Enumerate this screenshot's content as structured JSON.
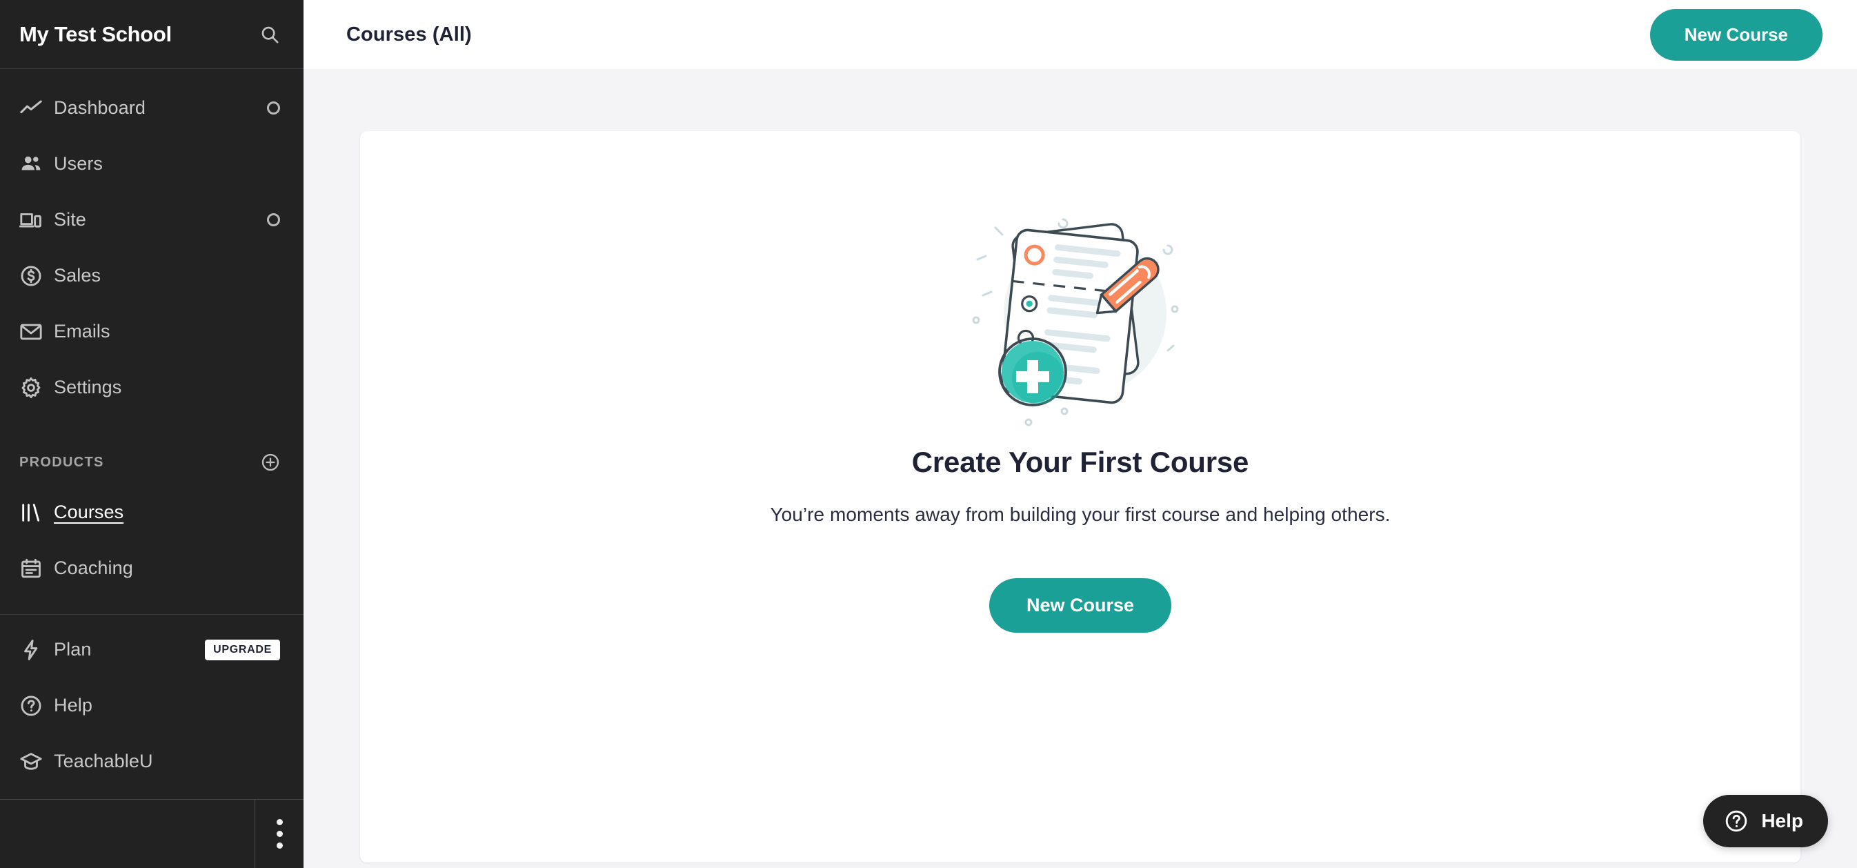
{
  "sidebar": {
    "brand": "My Test School",
    "search_icon": "search-icon",
    "nav": [
      {
        "label": "Dashboard",
        "icon": "trend-line-icon",
        "indicator": "ring",
        "active": false
      },
      {
        "label": "Users",
        "icon": "people-icon",
        "indicator": "",
        "active": false
      },
      {
        "label": "Site",
        "icon": "devices-icon",
        "indicator": "ring",
        "active": false
      },
      {
        "label": "Sales",
        "icon": "dollar-circle-icon",
        "indicator": "",
        "active": false
      },
      {
        "label": "Emails",
        "icon": "envelope-icon",
        "indicator": "",
        "active": false
      },
      {
        "label": "Settings",
        "icon": "gear-icon",
        "indicator": "",
        "active": false
      }
    ],
    "products": {
      "title": "PRODUCTS",
      "add_icon": "plus-circle-icon",
      "items": [
        {
          "label": "Courses",
          "icon": "books-icon",
          "active": true
        },
        {
          "label": "Coaching",
          "icon": "calendar-icon",
          "active": false
        }
      ]
    },
    "utility": [
      {
        "label": "Plan",
        "icon": "bolt-icon",
        "badge": "UPGRADE"
      },
      {
        "label": "Help",
        "icon": "question-circle-icon",
        "badge": ""
      },
      {
        "label": "TeachableU",
        "icon": "graduation-cap-icon",
        "badge": ""
      }
    ],
    "footer_menu_icon": "kebab-menu-icon"
  },
  "header": {
    "title": "Courses (All)",
    "new_course_label": "New Course"
  },
  "empty_state": {
    "illustration": "document-pencil-add-illustration",
    "title": "Create Your First Course",
    "subtitle": "You’re moments away from building your first course and helping others.",
    "cta_label": "New Course"
  },
  "help_widget": {
    "label": "Help",
    "icon": "question-circle-icon"
  },
  "colors": {
    "accent_teal": "#1ba098",
    "sidebar_bg": "#222222",
    "page_bg": "#f4f4f7",
    "text_navy": "#1f2235",
    "pencil_orange": "#f9885c",
    "illus_line": "#3d4a52"
  }
}
